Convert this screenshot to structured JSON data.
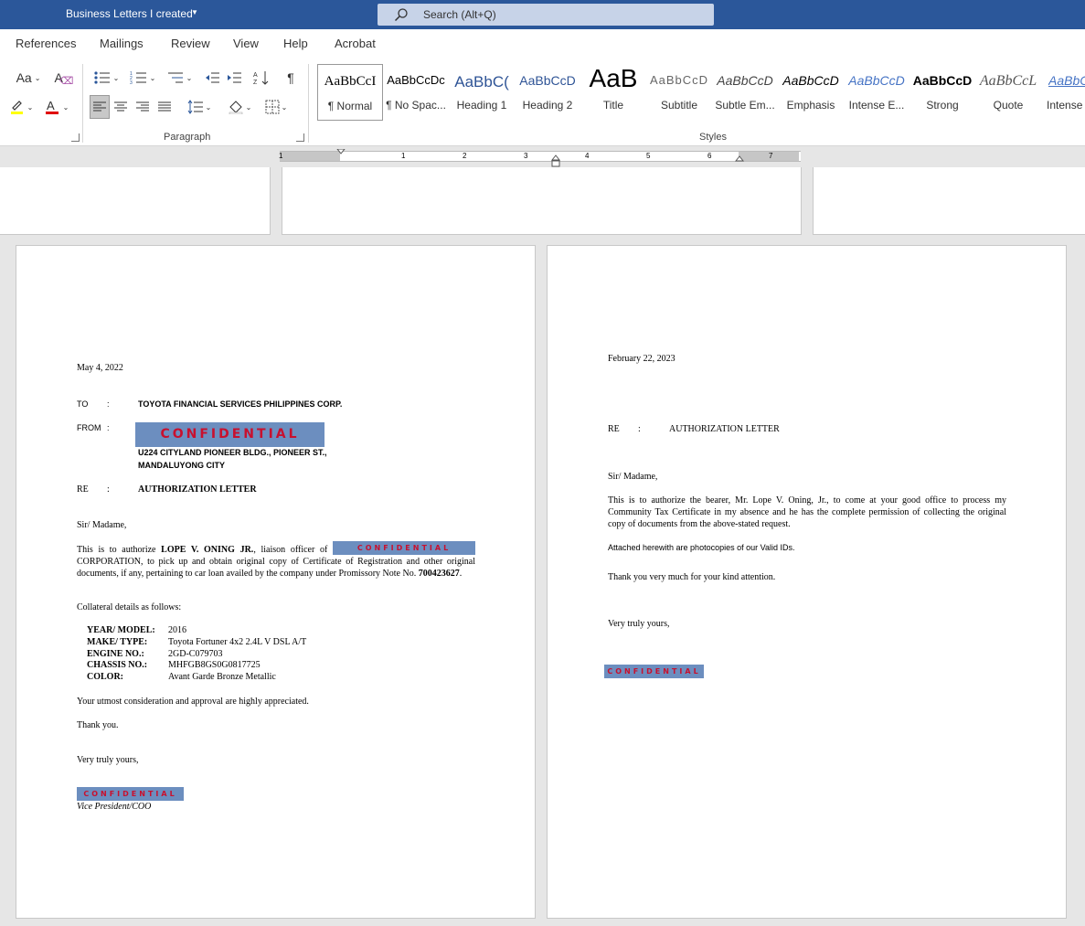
{
  "titlebar": {
    "doc_title": "Business Letters I created",
    "search_placeholder": "Search (Alt+Q)"
  },
  "menu": [
    "References",
    "Mailings",
    "Review",
    "View",
    "Help",
    "Acrobat"
  ],
  "ribbon": {
    "paragraph_label": "Paragraph",
    "styles_label": "Styles",
    "styles": [
      {
        "sample": "AaBbCcI",
        "name": "¶ Normal"
      },
      {
        "sample": "AaBbCcDc",
        "name": "¶ No Spac..."
      },
      {
        "sample": "AaBbC(",
        "name": "Heading 1"
      },
      {
        "sample": "AaBbCcD",
        "name": "Heading 2"
      },
      {
        "sample": "AaB",
        "name": "Title"
      },
      {
        "sample": "AaBbCcD",
        "name": "Subtitle"
      },
      {
        "sample": "AaBbCcD",
        "name": "Subtle Em..."
      },
      {
        "sample": "AaBbCcD",
        "name": "Emphasis"
      },
      {
        "sample": "AaBbCcD",
        "name": "Intense E..."
      },
      {
        "sample": "AaBbCcD",
        "name": "Strong"
      },
      {
        "sample": "AaBbCcL",
        "name": "Quote"
      },
      {
        "sample": "AaBbC",
        "name": "Intense"
      }
    ]
  },
  "ruler": {
    "numbers": [
      "1",
      "1",
      "2",
      "3",
      "4",
      "5",
      "6",
      "7"
    ]
  },
  "colors": {
    "titlebar": "#2b579a",
    "confidential_bg": "#6c8ebf",
    "confidential_text": "#c8102e"
  },
  "letter1": {
    "date": "May 4, 2022",
    "to_label": "TO",
    "colon": ":",
    "to_value": "TOYOTA FINANCIAL SERVICES PHILIPPINES CORP.",
    "from_label": "FROM",
    "confidential": "CONFIDENTIAL",
    "address1": "U224 CITYLAND PIONEER BLDG., PIONEER ST.,",
    "address2": "MANDALUYONG CITY",
    "re_label": "RE",
    "re_value": "AUTHORIZATION LETTER",
    "salutation": "Sir/ Madame,",
    "body_p1": "This is to authorize",
    "body_name": "LOPE V. ONING JR.",
    "body_p2": ", liaison officer of",
    "body_p3": "CORPORATION, to pick up and obtain original copy of Certificate of Registration and other original documents, if any, pertaining to car loan availed by the company under Promissory Note No.",
    "note_no": "700423627",
    "collateral_intro": "Collateral details as follows:",
    "details": [
      {
        "label": "YEAR/ MODEL:",
        "value": "2016"
      },
      {
        "label": "MAKE/ TYPE:",
        "value": "Toyota Fortuner 4x2 2.4L V DSL A/T"
      },
      {
        "label": "ENGINE NO.:",
        "value": "2GD-C079703"
      },
      {
        "label": "CHASSIS NO.:",
        "value": "MHFGB8GS0G0817725"
      },
      {
        "label": "COLOR:",
        "value": "Avant Garde Bronze Metallic"
      }
    ],
    "appreciation": "Your utmost consideration and approval are highly appreciated.",
    "thanks": "Thank you.",
    "closing": "Very truly yours,",
    "signatory_title": "Vice President/COO"
  },
  "letter2": {
    "date": "February 22, 2023",
    "re_label": "RE",
    "colon": ":",
    "re_value": "AUTHORIZATION LETTER",
    "salutation": "Sir/ Madame,",
    "body": "This is to authorize the bearer, Mr. Lope V. Oning, Jr., to come at your good office to process my Community Tax Certificate in my absence and he has the complete permission of collecting the original copy of documents from the above-stated request.",
    "attached": "Attached herewith are photocopies of our Valid IDs.",
    "thanks": "Thank you very much for your kind attention.",
    "closing": "Very truly yours,",
    "confidential": "CONFIDENTIAL"
  }
}
